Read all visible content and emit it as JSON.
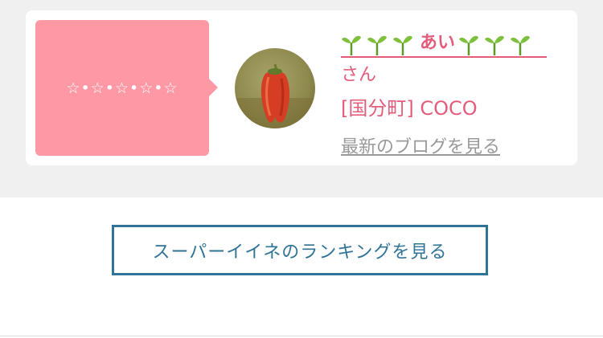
{
  "profile": {
    "message": "☆•☆•☆•☆•☆",
    "name": "あい",
    "honorific": "さん",
    "shop": "[国分町] COCO",
    "blog_link": "最新のブログを見る"
  },
  "ranking_button": "スーパーイイネのランキングを見る",
  "colors": {
    "pink": "#fd98a4",
    "accent": "#e35d7b",
    "blue": "#2f7396",
    "link_gray": "#999999"
  }
}
